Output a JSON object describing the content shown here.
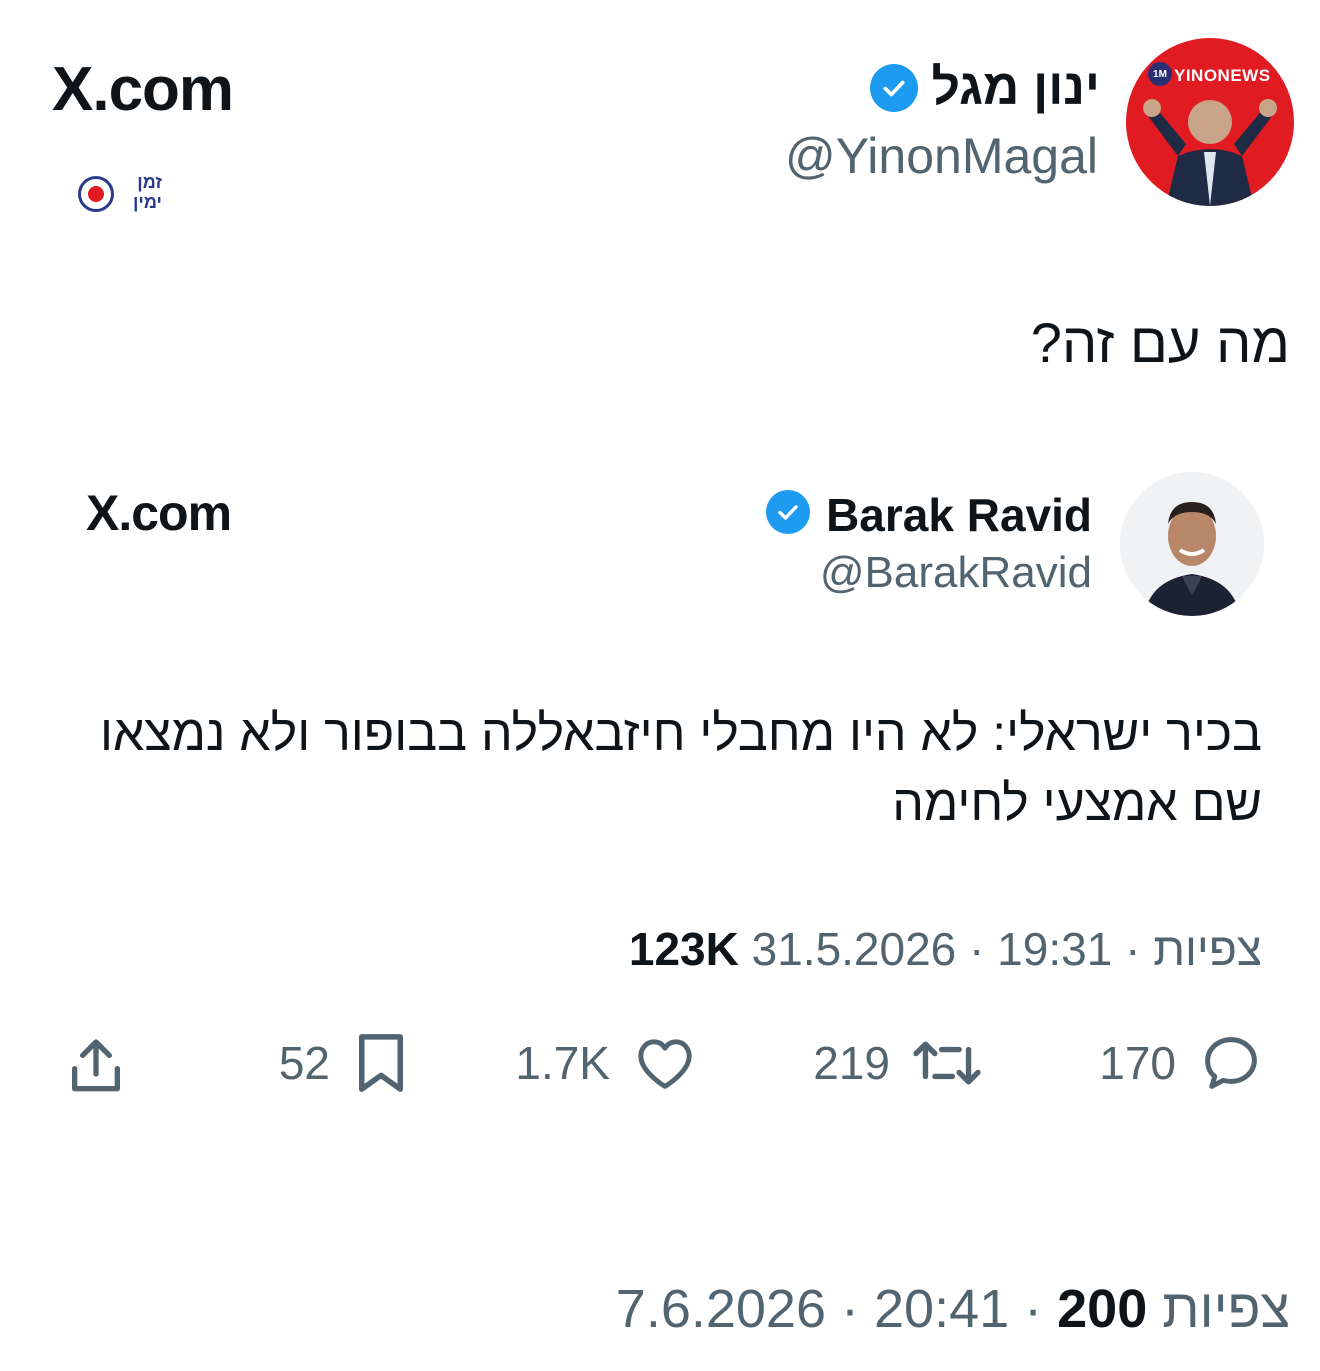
{
  "outer_tweet": {
    "brand": "X.com",
    "channel_logo_text": "זמן ימין",
    "avatar_label": "YINONEWS",
    "avatar_badge": "1M",
    "name": "ינון מגל",
    "handle": "@YinonMagal",
    "text": "מה עם זה?",
    "meta": {
      "date": "7.6.2026",
      "time": "20:41",
      "views_count": "200",
      "views_label": "צפיות"
    }
  },
  "quoted_tweet": {
    "brand": "X.com",
    "name": "Barak Ravid",
    "handle": "@BarakRavid",
    "text": "בכיר ישראלי: לא היו מחבלי חיזבאללה בבופור ולא נמצאו שם אמצעי לחימה",
    "meta": {
      "date": "31.5.2026",
      "time": "19:31",
      "views_label": "צפיות",
      "views_count": "123K"
    },
    "actions": {
      "replies": "170",
      "retweets": "219",
      "likes": "1.7K",
      "bookmarks": "52"
    }
  },
  "icons": [
    "x-logo-icon",
    "verified-badge-icon",
    "reply-icon",
    "retweet-icon",
    "like-icon",
    "bookmark-icon",
    "share-icon"
  ],
  "colors": {
    "verified": "#1d9bf0",
    "secondary_text": "#536471",
    "avatar_red": "#e11b22"
  }
}
